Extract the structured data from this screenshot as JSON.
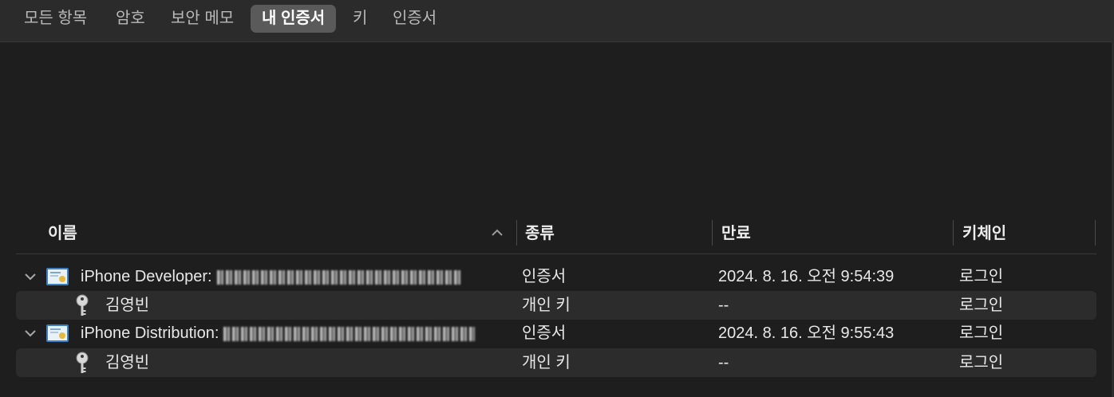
{
  "tabs": [
    {
      "label": "모든 항목",
      "active": false
    },
    {
      "label": "암호",
      "active": false
    },
    {
      "label": "보안 메모",
      "active": false
    },
    {
      "label": "내 인증서",
      "active": true
    },
    {
      "label": "키",
      "active": false
    },
    {
      "label": "인증서",
      "active": false
    }
  ],
  "table": {
    "columns": {
      "name": "이름",
      "kind": "종류",
      "expires": "만료",
      "keychain": "키체인"
    },
    "rows": [
      {
        "name": "iPhone Developer:",
        "kind": "인증서",
        "expires": "2024. 8. 16. 오전 9:54:39",
        "keychain": "로그인",
        "icon": "certificate-icon",
        "expanded": true
      },
      {
        "name": "김영빈",
        "kind": "개인 키",
        "expires": "--",
        "keychain": "로그인",
        "icon": "key-icon"
      },
      {
        "name": "iPhone Distribution:",
        "kind": "인증서",
        "expires": "2024. 8. 16. 오전 9:55:43",
        "keychain": "로그인",
        "icon": "certificate-icon",
        "expanded": true
      },
      {
        "name": "김영빈",
        "kind": "개인 키",
        "expires": "--",
        "keychain": "로그인",
        "icon": "key-icon"
      }
    ]
  },
  "colors": {
    "background": "#1e1e1e",
    "tabbar": "#2b2b2b",
    "active_tab": "#5a5a5a",
    "row_alt": "#2c2c2c"
  }
}
